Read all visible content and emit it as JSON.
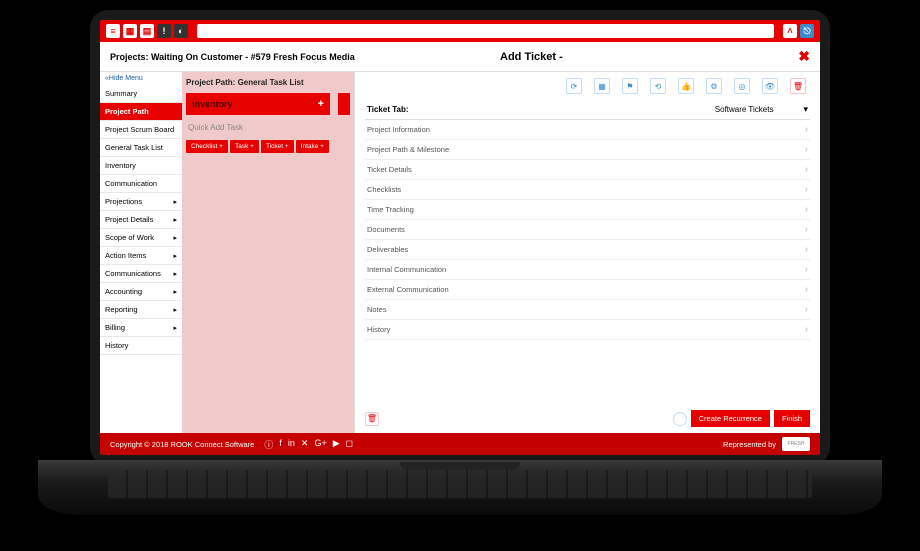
{
  "topbar": {
    "search_placeholder": ""
  },
  "breadcrumb": "Projects: Waiting On Customer - #579 Fresh Focus Media",
  "panel_title": "Add Ticket -",
  "sidebar": {
    "hide": "«Hide Menu",
    "items": [
      {
        "label": "Summary",
        "active": false,
        "expand": false
      },
      {
        "label": "Project Path",
        "active": true,
        "expand": false
      },
      {
        "label": "Project Scrum Board",
        "active": false,
        "expand": false
      },
      {
        "label": "General Task List",
        "active": false,
        "expand": false
      },
      {
        "label": "Inventory",
        "active": false,
        "expand": false
      },
      {
        "label": "Communication",
        "active": false,
        "expand": false
      },
      {
        "label": "Projections",
        "active": false,
        "expand": true
      },
      {
        "label": "Project Details",
        "active": false,
        "expand": true
      },
      {
        "label": "Scope of Work",
        "active": false,
        "expand": true
      },
      {
        "label": "Action Items",
        "active": false,
        "expand": true
      },
      {
        "label": "Communications",
        "active": false,
        "expand": true
      },
      {
        "label": "Accounting",
        "active": false,
        "expand": true
      },
      {
        "label": "Reporting",
        "active": false,
        "expand": true
      },
      {
        "label": "Billing",
        "active": false,
        "expand": true
      },
      {
        "label": "History",
        "active": false,
        "expand": false
      }
    ]
  },
  "mid": {
    "path": "Project Path: General Task List",
    "section": "Inventory",
    "quick_add": "Quick Add Task",
    "chips": [
      "Checklist +",
      "Task +",
      "Ticket +",
      "Intake +"
    ]
  },
  "ticket": {
    "tab_label": "Ticket Tab:",
    "tab_value": "Software Tickets",
    "sections": [
      "Project Information",
      "Project Path & Milestone",
      "Ticket Details",
      "Checklists",
      "Time Tracking",
      "Documents",
      "Deliverables",
      "Internal Communication",
      "External Communication",
      "Notes",
      "History"
    ],
    "create": "Create Recurrence",
    "finish": "Finish"
  },
  "footer": {
    "copy": "Copyright © 2018 ROOK Connect Software",
    "rep": "Represented by",
    "brand": "FRESH"
  }
}
